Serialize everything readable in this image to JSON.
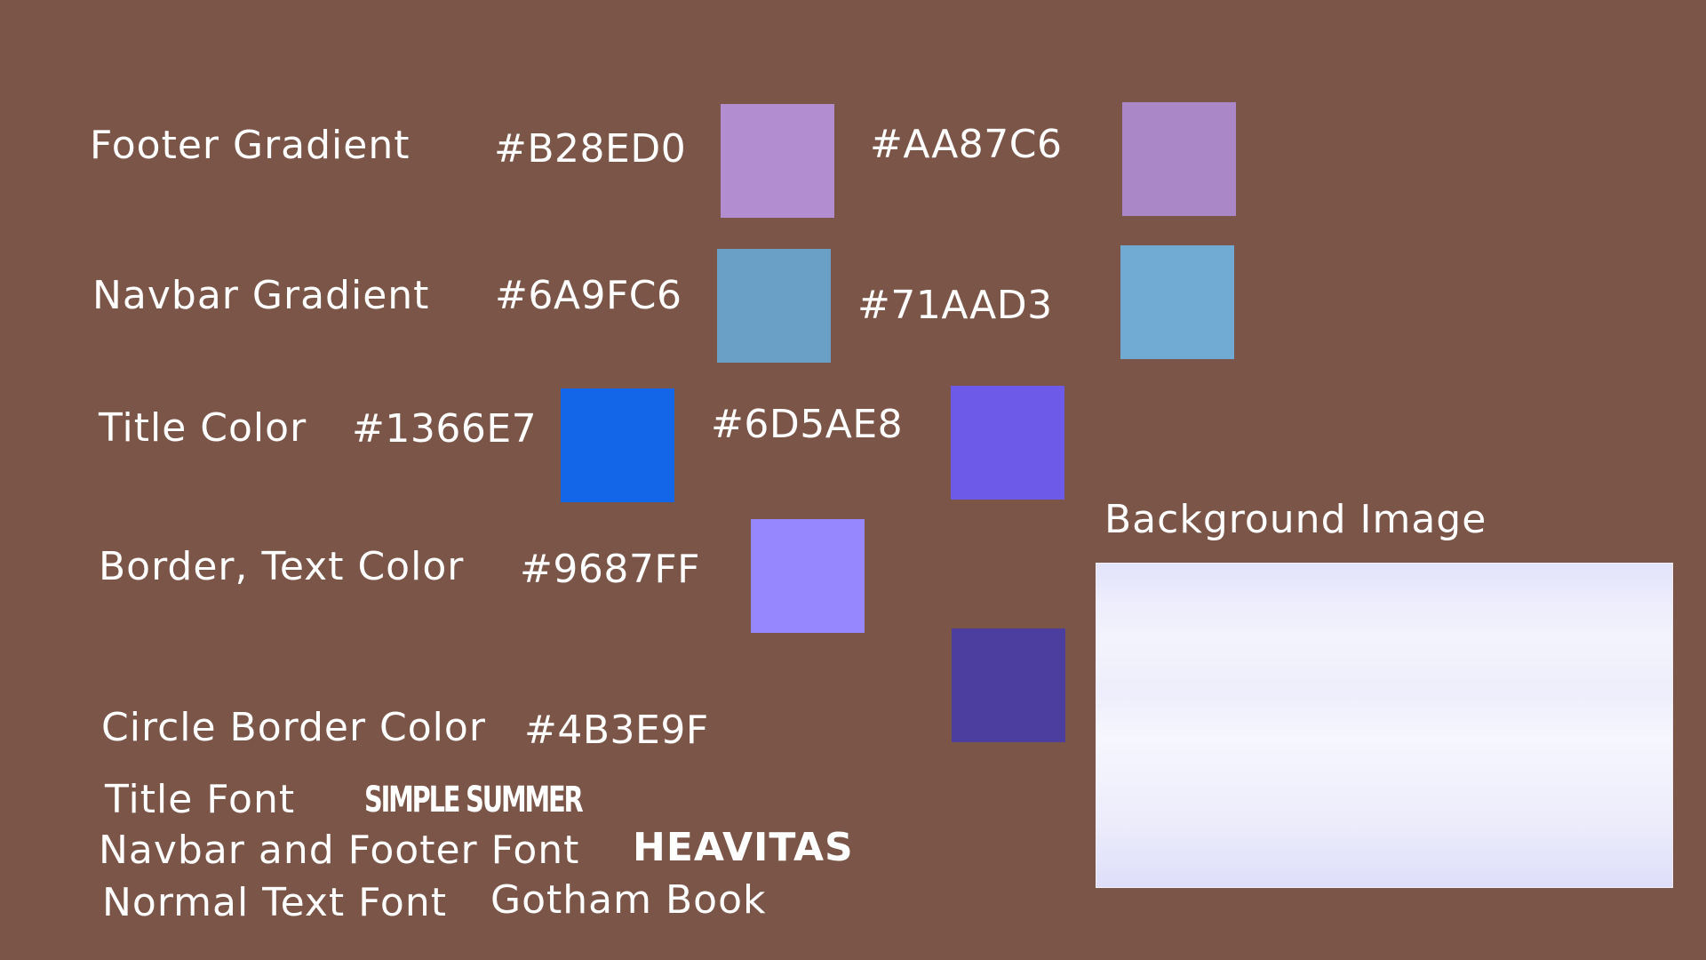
{
  "rows": {
    "footer_gradient": {
      "label": "Footer Gradient",
      "hex1": "#B28ED0",
      "hex2": "#AA87C6"
    },
    "navbar_gradient": {
      "label": "Navbar Gradient",
      "hex1": "#6A9FC6",
      "hex2": "#71AAD3"
    },
    "title_color": {
      "label": "Title Color",
      "hex1": "#1366E7",
      "hex2": "#6D5AE8"
    },
    "border_text_color": {
      "label": "Border, Text Color",
      "hex1": "#9687FF"
    },
    "circle_border_color": {
      "label": "Circle Border Color",
      "hex1": "#4B3E9F"
    }
  },
  "fonts": {
    "title": {
      "label": "Title Font",
      "sample": "SIMPLE SUMMER"
    },
    "navbar_footer": {
      "label": "Navbar and Footer Font",
      "sample": "HEAVITAS"
    },
    "normal_text": {
      "label": "Normal Text Font",
      "sample": "Gotham Book"
    }
  },
  "background": {
    "label": "Background Image"
  },
  "colors": {
    "page_background": "#7A5548",
    "background_image_top": "#E3E3FB",
    "background_image_mid": "#F6F6FE",
    "background_image_bottom": "#DEDEFA"
  }
}
